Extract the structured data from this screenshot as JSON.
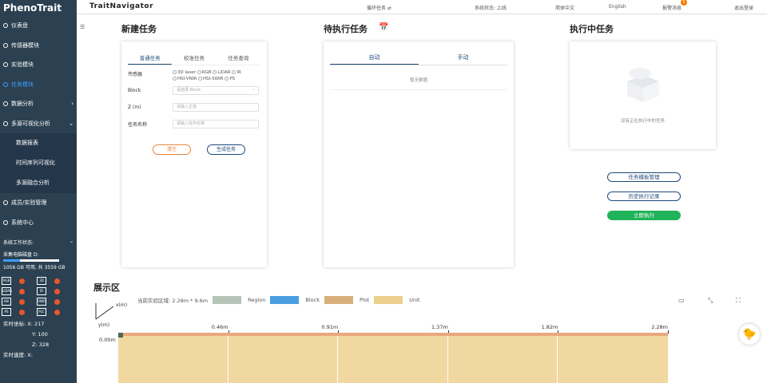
{
  "sidebar": {
    "logo": "PhenoTrait",
    "items": [
      {
        "label": "仪表盘"
      },
      {
        "label": "传感器模块"
      },
      {
        "label": "实验模块"
      },
      {
        "label": "任务模块"
      },
      {
        "label": "数据分析"
      },
      {
        "label": "多源可视化分析"
      }
    ],
    "sub_items": [
      {
        "label": "数据报表"
      },
      {
        "label": "时间序列可视化"
      },
      {
        "label": "多源融合分析"
      }
    ],
    "more_items": [
      {
        "label": "成员/实验管理"
      },
      {
        "label": "系统中心"
      }
    ],
    "sys_title": "系统工作状态:",
    "disk_label": "采集电脑磁盘 D:",
    "disk_usage": 0.3,
    "disk_text": "1056 GB 可用, 共 3559 GB",
    "sensors": [
      "RGB",
      "3D",
      "LIDAR",
      "IR",
      "HSI",
      "VNIR",
      "PS",
      "PLC"
    ],
    "coord_label": "实时坐标:",
    "x": "X:  217",
    "y": "Y:  100",
    "z": "Z:  328",
    "speed_label": "实时速度:",
    "speed_x": "X:"
  },
  "topbar": {
    "title": "TraitNavigator",
    "loop": "循环任务 ⇄",
    "status": "系统状态: 上线",
    "lang_cn": "简体中文",
    "lang_en": "English",
    "alarm": "报警消息",
    "alarm_count": "5",
    "logout": "退出登录"
  },
  "new_task": {
    "title": "新建任务",
    "tabs": [
      "普通任务",
      "校准任务",
      "任务查询"
    ],
    "sensor_label": "传感器",
    "sensor_opts": [
      "3D laser",
      "RGB",
      "LiDAR",
      "IR",
      "HSI-VNIR",
      "HSI-SWIR",
      "PS"
    ],
    "block_label": "Block",
    "block_placeholder": "请选择 Block",
    "z_label": "Z (m)",
    "z_placeholder": "请输入正值",
    "name_label": "任务名称",
    "name_placeholder": "请输入任务名称",
    "reset": "清空",
    "generate": "生成任务"
  },
  "pending": {
    "title": "待执行任务",
    "tabs": [
      "自动",
      "手动"
    ],
    "empty": "暂无数据"
  },
  "running": {
    "title": "执行中任务",
    "empty": "没有正在执行中的任务",
    "btn_template": "任务模板管理",
    "btn_history": "历史执行记录",
    "btn_run": "立即执行"
  },
  "display": {
    "title": "展示区",
    "area_text": "当前实验区域:  2.28m * 9.6m",
    "legend": [
      {
        "name": "Region",
        "color": "#b5c6b8"
      },
      {
        "name": "Block",
        "color": "#4a9ee0"
      },
      {
        "name": "Plot",
        "color": "#d8b07c"
      },
      {
        "name": "Unit",
        "color": "#ecd08e"
      }
    ],
    "x_axis": "x(m)",
    "y_axis": "y(m)",
    "ticks": [
      "0.46m",
      "0.91m",
      "1.37m",
      "1.82m",
      "2.28m"
    ],
    "y0": "0.00m"
  }
}
